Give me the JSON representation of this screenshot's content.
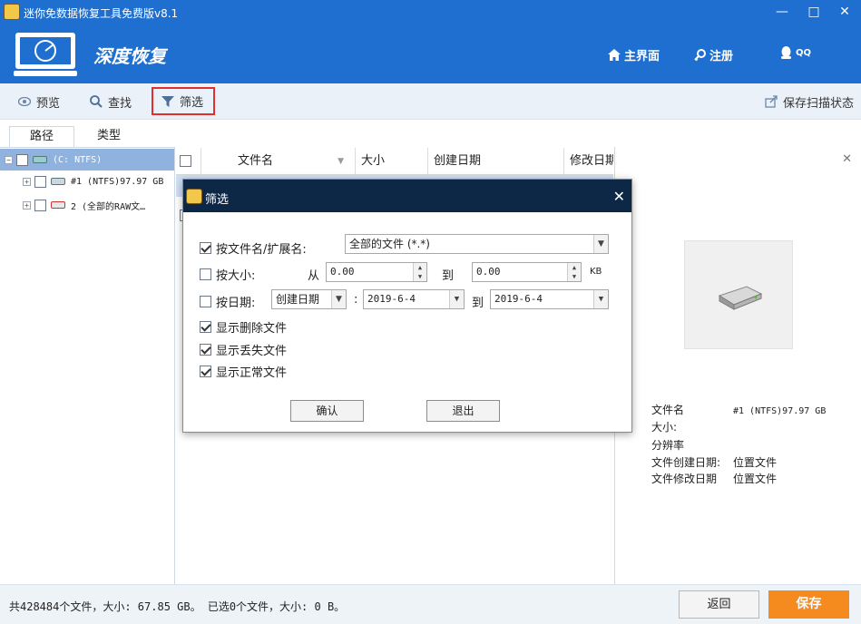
{
  "app": {
    "title": "迷你免数据恢复工具免费版v8.1",
    "brand": "深度恢复"
  },
  "nav": {
    "home": "主界面",
    "register": "注册",
    "qq": "QQ"
  },
  "toolbar": {
    "preview": "预览",
    "find": "查找",
    "filter": "筛选",
    "save_scan": "保存扫描状态"
  },
  "tabs": {
    "path": "路径",
    "type": "类型"
  },
  "tree": [
    {
      "label": "(C: NTFS)"
    },
    {
      "label": "#1 (NTFS)97.97 GB"
    },
    {
      "label": "2 (全部的RAW文…"
    }
  ],
  "list": {
    "col_name": "文件名",
    "col_size": "大小",
    "col_created": "创建日期",
    "col_modified": "修改日期"
  },
  "preview": {
    "filename_label": "文件名",
    "filename_value": "#1 (NTFS)97.97 GB",
    "size_label": "大小:",
    "resolution_label": "分辨率",
    "created_label": "文件创建日期:",
    "created_value": "位置文件",
    "modified_label": "文件修改日期",
    "modified_value": "位置文件"
  },
  "status": {
    "text": "共428484个文件，大小: 67.85 GB。 已选0个文件，大小: 0 B。",
    "back": "返回",
    "save": "保存"
  },
  "dialog": {
    "title": "筛选",
    "by_name_label": "按文件名/扩展名:",
    "by_name_value": "全部的文件 (*.*)",
    "by_size_label": "按大小:",
    "from_label": "从",
    "size_from": "0.00",
    "to_label": "到",
    "size_to": "0.00",
    "size_unit": "KB",
    "by_date_label": "按日期:",
    "date_type": "创建日期",
    "date_colon": ":",
    "date_from": "2019-6-4",
    "date_to": "2019-6-4",
    "show_deleted": "显示删除文件",
    "show_lost": "显示丢失文件",
    "show_normal": "显示正常文件",
    "confirm": "确认",
    "exit": "退出"
  },
  "colors": {
    "header_blue": "#1e6fd0",
    "dialog_title": "#0d2746",
    "save_orange": "#f58b1f",
    "highlight_red": "#e0302d"
  }
}
